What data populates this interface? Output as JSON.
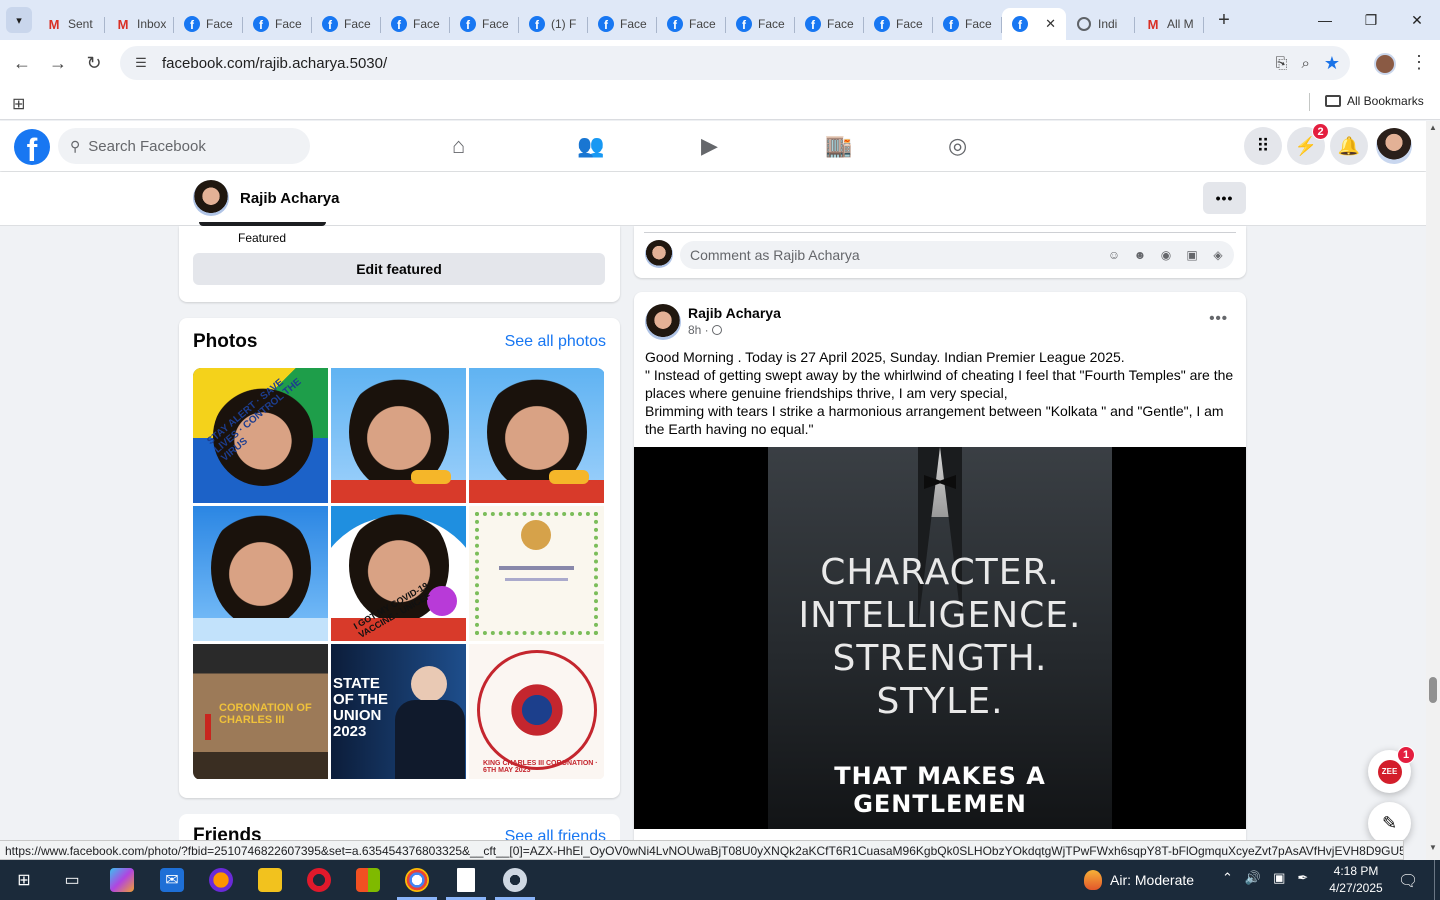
{
  "browser": {
    "tabs": [
      {
        "label": "Sent",
        "icon": "gmail-icon",
        "active": false
      },
      {
        "label": "Inbox",
        "icon": "gmail-icon",
        "active": false
      },
      {
        "label": "Face",
        "icon": "facebook-icon",
        "active": false
      },
      {
        "label": "Face",
        "icon": "facebook-icon",
        "active": false
      },
      {
        "label": "Face",
        "icon": "facebook-icon",
        "active": false
      },
      {
        "label": "Face",
        "icon": "facebook-icon",
        "active": false
      },
      {
        "label": "Face",
        "icon": "facebook-icon",
        "active": false
      },
      {
        "label": "(1) F",
        "icon": "facebook-icon",
        "active": false
      },
      {
        "label": "Face",
        "icon": "facebook-icon",
        "active": false
      },
      {
        "label": "Face",
        "icon": "facebook-icon",
        "active": false
      },
      {
        "label": "Face",
        "icon": "facebook-icon",
        "active": false
      },
      {
        "label": "Face",
        "icon": "facebook-icon",
        "active": false
      },
      {
        "label": "Face",
        "icon": "facebook-icon",
        "active": false
      },
      {
        "label": "Face",
        "icon": "facebook-icon",
        "active": false
      },
      {
        "label": "",
        "icon": "facebook-icon",
        "active": true
      },
      {
        "label": "Indi",
        "icon": "globe-icon",
        "active": false
      },
      {
        "label": "All M",
        "icon": "gmail-icon",
        "active": false
      }
    ],
    "url": "facebook.com/rajib.acharya.5030/",
    "bookmarks_label": "All Bookmarks",
    "status_url": "https://www.facebook.com/photo/?fbid=2510746822607395&set=a.635454376803325&__cft__[0]=AZX-HhEl_OyOV0wNi4LvNOUwaBjT08U0yXNQk2aKCfT6R1CuasaM96KgbQk0SLHObzYOkdqtgWjTPwFWxh6sqpY8T-bFlOgmquXcyeZvt7pAsAVfHvjEVH8D9GU5D6itl..."
  },
  "fb": {
    "search_placeholder": "Search Facebook",
    "messenger_badge": "2",
    "profile_name": "Rajib Acharya",
    "featured_label": "Featured",
    "edit_featured": "Edit featured",
    "photos_title": "Photos",
    "see_all_photos": "See all photos",
    "friends_title": "Friends",
    "see_all_friends": "See all friends",
    "comment_placeholder": "Comment as Rajib Acharya",
    "post": {
      "author": "Rajib Acharya",
      "time": "8h ·",
      "lines": [
        "Good Morning . Today is 27 April 2025, Sunday. Indian Premier League 2025.",
        "\" Instead of getting swept away by the whirlwind of cheating I feel that \"Fourth Temples\" are the places where genuine friendships thrive, I am very special,",
        "Brimming with tears I strike a harmonious arrangement between \"Kolkata \" and \"Gentle\", I am the Earth having no equal.\""
      ],
      "image_text": [
        "CHARACTER.",
        "INTELLIGENCE.",
        "STRENGTH.",
        "STYLE.",
        "THAT MAKES A",
        "GENTLEMEN"
      ]
    },
    "photos": [
      {
        "caption": "STAY ALERT · SAVE LIVES · CONTROL THE VIRUS"
      },
      {
        "caption": ""
      },
      {
        "caption": ""
      },
      {
        "caption": ""
      },
      {
        "caption": "I GOT MY COVID-19 VACCINE · UNICEF"
      },
      {
        "caption": ""
      },
      {
        "caption": "CORONATION OF CHARLES III"
      },
      {
        "caption": "STATE OF THE UNION 2023"
      },
      {
        "caption": "KING CHARLES III CORONATION · 6TH MAY 2023"
      }
    ],
    "news_badge": "1"
  },
  "taskbar": {
    "weather": "Air: Moderate",
    "time": "4:18 PM",
    "date": "4/27/2025"
  }
}
